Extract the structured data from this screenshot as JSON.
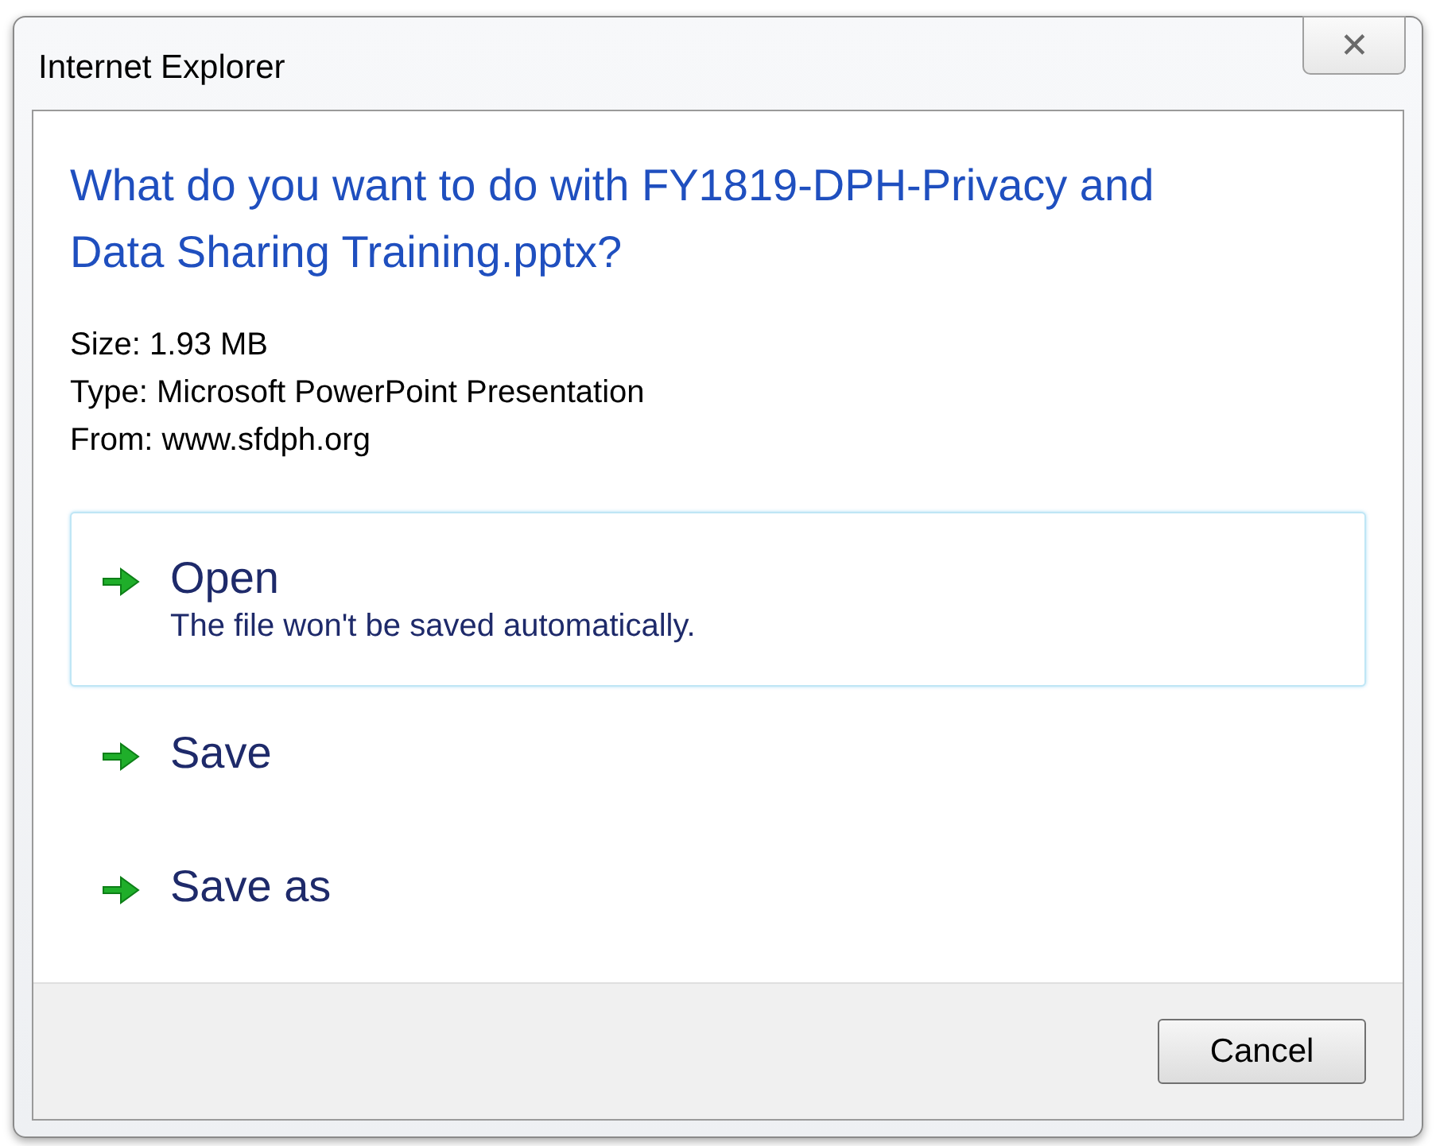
{
  "window": {
    "title": "Internet Explorer",
    "close": "✕"
  },
  "question": "What do you want to do with FY1819-DPH-Privacy and Data Sharing Training.pptx?",
  "details": [
    "Size: 1.93 MB",
    "Type: Microsoft PowerPoint Presentation",
    "From: www.sfdph.org"
  ],
  "options": [
    {
      "label": "Open",
      "description": "The file won't be saved automatically.",
      "selected": true
    },
    {
      "label": "Save",
      "selected": false
    },
    {
      "label": "Save as",
      "selected": false
    }
  ],
  "buttons": [
    "Cancel"
  ]
}
